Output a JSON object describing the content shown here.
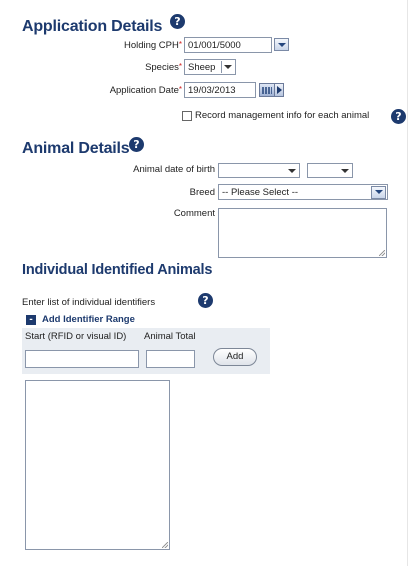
{
  "application_details": {
    "heading": "Application Details",
    "holding_cph_label": "Holding CPH",
    "holding_cph_value": "01/001/5000",
    "species_label": "Species",
    "species_value": "Sheep",
    "application_date_label": "Application Date",
    "application_date_value": "19/03/2013",
    "record_mgmt_label": "Record management info for each animal",
    "required_mark": "*"
  },
  "animal_details": {
    "heading": "Animal Details",
    "dob_label": "Animal date of birth",
    "dob_day_value": "",
    "dob_month_value": "",
    "breed_label": "Breed",
    "breed_value": "-- Please Select --",
    "comment_label": "Comment"
  },
  "individual_animals": {
    "heading": "Individual Identified Animals",
    "enter_list_label": "Enter list of individual identifiers",
    "add_range_label": "Add Identifier Range",
    "start_col": "Start (RFID or visual ID)",
    "total_col": "Animal Total",
    "add_button": "Add",
    "collapse_symbol": "-"
  },
  "icons": {
    "help": "?"
  },
  "colors": {
    "heading": "#1d3a6e",
    "required": "#d02020",
    "band": "#e9edf2"
  }
}
